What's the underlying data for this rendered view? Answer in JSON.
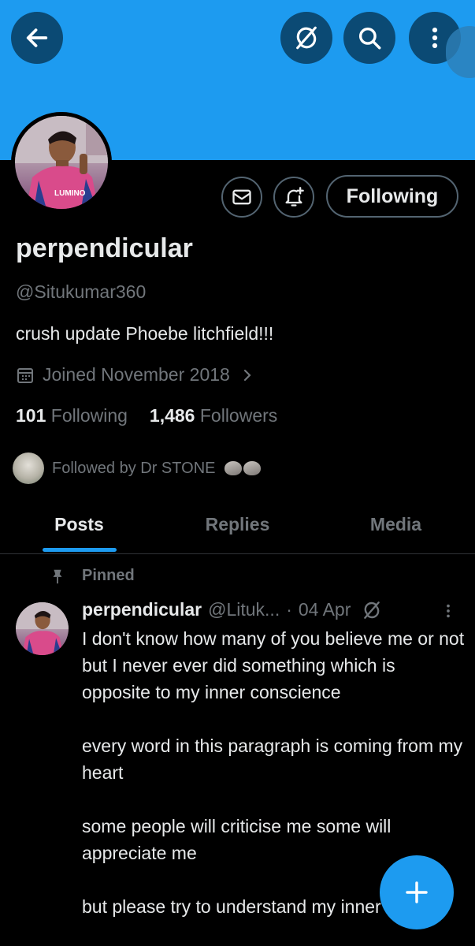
{
  "header": {
    "back_icon": "arrow-left-icon",
    "grok_icon": "grok-icon",
    "search_icon": "search-icon",
    "more_icon": "more-vertical-icon",
    "banner_color": "#1d9bf0"
  },
  "profile": {
    "display_name": "perpendicular",
    "handle": "@Situkumar360",
    "bio": "crush update Phoebe litchfield!!!",
    "joined": "Joined November 2018",
    "following_count": "101",
    "following_label": "Following",
    "followers_count": "1,486",
    "followers_label": "Followers",
    "followed_by": "Followed by Dr STONE",
    "avatar_jersey_text": "LUMINO"
  },
  "actions": {
    "message_icon": "envelope-icon",
    "notify_icon": "bell-plus-icon",
    "follow_label": "Following"
  },
  "tabs": [
    {
      "label": "Posts",
      "active": true
    },
    {
      "label": "Replies",
      "active": false
    },
    {
      "label": "Media",
      "active": false
    }
  ],
  "post": {
    "pinned_label": "Pinned",
    "author_name": "perpendicular",
    "author_handle": "@Lituk...",
    "separator": "·",
    "date": "04 Apr",
    "text": "I don't know how many of you believe me or not\nbut I never ever did something which is opposite to my inner conscience\n\nevery word in this paragraph is coming from my heart\n\nsome people will criticise me some will appreciate me\n\nbut please try to understand my inner"
  },
  "fab": {
    "icon": "plus-icon",
    "color": "#1d9bf0"
  }
}
